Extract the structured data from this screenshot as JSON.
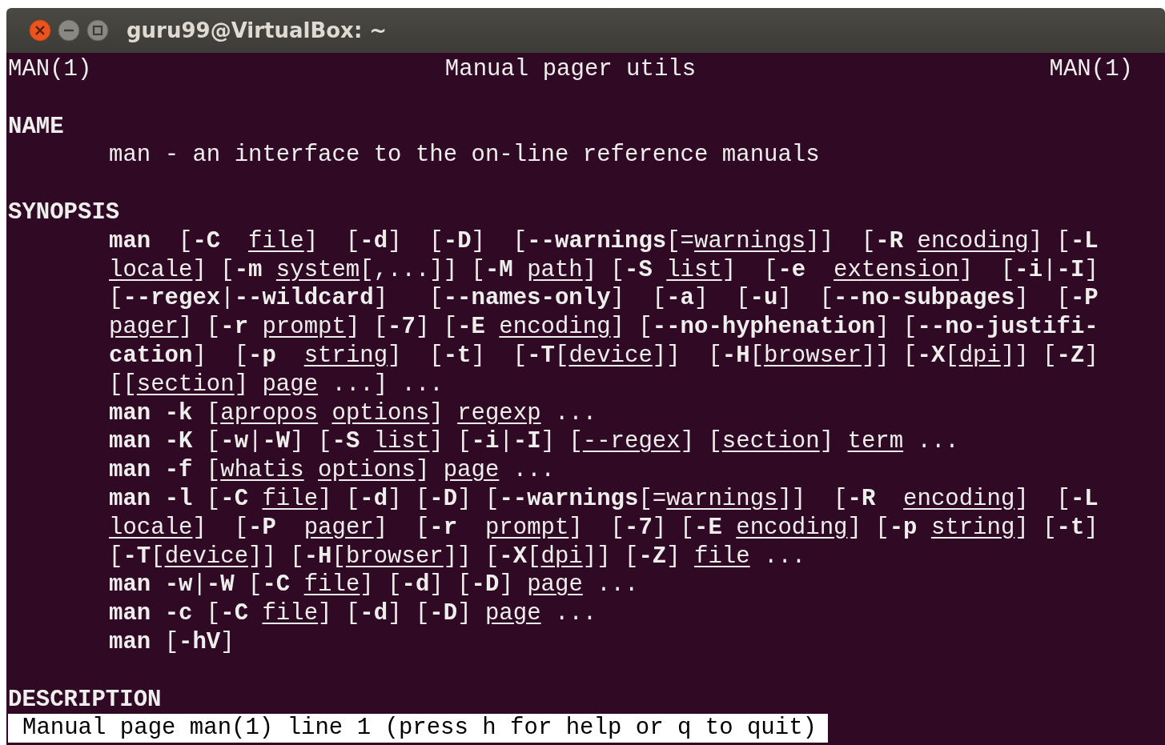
{
  "window": {
    "title": "guru99@VirtualBox: ~"
  },
  "header": {
    "left": "MAN(1)",
    "center": "Manual pager utils",
    "right": "MAN(1)"
  },
  "sections": [
    {
      "heading": "NAME",
      "lines": [
        [
          {
            "kind": "plain",
            "text": "man - an interface to the on-line reference manuals"
          }
        ]
      ]
    },
    {
      "heading": "SYNOPSIS",
      "lines": [
        [
          {
            "kind": "bold",
            "text": "man"
          },
          {
            "kind": "plain",
            "text": "  ["
          },
          {
            "kind": "bold",
            "text": "-C  "
          },
          {
            "kind": "underline",
            "text": "file"
          },
          {
            "kind": "plain",
            "text": "]  ["
          },
          {
            "kind": "bold",
            "text": "-d"
          },
          {
            "kind": "plain",
            "text": "]  ["
          },
          {
            "kind": "bold",
            "text": "-D"
          },
          {
            "kind": "plain",
            "text": "]  ["
          },
          {
            "kind": "bold",
            "text": "--warnings"
          },
          {
            "kind": "plain",
            "text": "[="
          },
          {
            "kind": "underline",
            "text": "warnings"
          },
          {
            "kind": "plain",
            "text": "]]  ["
          },
          {
            "kind": "bold",
            "text": "-R "
          },
          {
            "kind": "underline",
            "text": "encoding"
          },
          {
            "kind": "plain",
            "text": "] ["
          },
          {
            "kind": "bold",
            "text": "-L"
          }
        ],
        [
          {
            "kind": "underline",
            "text": "locale"
          },
          {
            "kind": "plain",
            "text": "] ["
          },
          {
            "kind": "bold",
            "text": "-m "
          },
          {
            "kind": "underline",
            "text": "system"
          },
          {
            "kind": "plain",
            "text": "[,...]] ["
          },
          {
            "kind": "bold",
            "text": "-M "
          },
          {
            "kind": "underline",
            "text": "path"
          },
          {
            "kind": "plain",
            "text": "] ["
          },
          {
            "kind": "bold",
            "text": "-S "
          },
          {
            "kind": "underline",
            "text": "list"
          },
          {
            "kind": "plain",
            "text": "]  ["
          },
          {
            "kind": "bold",
            "text": "-e  "
          },
          {
            "kind": "underline",
            "text": "extension"
          },
          {
            "kind": "plain",
            "text": "]  ["
          },
          {
            "kind": "bold",
            "text": "-i"
          },
          {
            "kind": "plain",
            "text": "|"
          },
          {
            "kind": "bold",
            "text": "-I"
          },
          {
            "kind": "plain",
            "text": "]"
          }
        ],
        [
          {
            "kind": "plain",
            "text": "["
          },
          {
            "kind": "bold",
            "text": "--regex"
          },
          {
            "kind": "plain",
            "text": "|"
          },
          {
            "kind": "bold",
            "text": "--wildcard"
          },
          {
            "kind": "plain",
            "text": "]   ["
          },
          {
            "kind": "bold",
            "text": "--names-only"
          },
          {
            "kind": "plain",
            "text": "]  ["
          },
          {
            "kind": "bold",
            "text": "-a"
          },
          {
            "kind": "plain",
            "text": "]  ["
          },
          {
            "kind": "bold",
            "text": "-u"
          },
          {
            "kind": "plain",
            "text": "]  ["
          },
          {
            "kind": "bold",
            "text": "--no-subpages"
          },
          {
            "kind": "plain",
            "text": "]  ["
          },
          {
            "kind": "bold",
            "text": "-P"
          }
        ],
        [
          {
            "kind": "underline",
            "text": "pager"
          },
          {
            "kind": "plain",
            "text": "] ["
          },
          {
            "kind": "bold",
            "text": "-r "
          },
          {
            "kind": "underline",
            "text": "prompt"
          },
          {
            "kind": "plain",
            "text": "] ["
          },
          {
            "kind": "bold",
            "text": "-7"
          },
          {
            "kind": "plain",
            "text": "] ["
          },
          {
            "kind": "bold",
            "text": "-E "
          },
          {
            "kind": "underline",
            "text": "encoding"
          },
          {
            "kind": "plain",
            "text": "] ["
          },
          {
            "kind": "bold",
            "text": "--no-hyphenation"
          },
          {
            "kind": "plain",
            "text": "] ["
          },
          {
            "kind": "bold",
            "text": "--no-justifi-"
          }
        ],
        [
          {
            "kind": "bold",
            "text": "cation"
          },
          {
            "kind": "plain",
            "text": "]  ["
          },
          {
            "kind": "bold",
            "text": "-p  "
          },
          {
            "kind": "underline",
            "text": "string"
          },
          {
            "kind": "plain",
            "text": "]  ["
          },
          {
            "kind": "bold",
            "text": "-t"
          },
          {
            "kind": "plain",
            "text": "]  ["
          },
          {
            "kind": "bold",
            "text": "-T"
          },
          {
            "kind": "plain",
            "text": "["
          },
          {
            "kind": "underline",
            "text": "device"
          },
          {
            "kind": "plain",
            "text": "]]  ["
          },
          {
            "kind": "bold",
            "text": "-H"
          },
          {
            "kind": "plain",
            "text": "["
          },
          {
            "kind": "underline",
            "text": "browser"
          },
          {
            "kind": "plain",
            "text": "]] ["
          },
          {
            "kind": "bold",
            "text": "-X"
          },
          {
            "kind": "plain",
            "text": "["
          },
          {
            "kind": "underline",
            "text": "dpi"
          },
          {
            "kind": "plain",
            "text": "]] ["
          },
          {
            "kind": "bold",
            "text": "-Z"
          },
          {
            "kind": "plain",
            "text": "]"
          }
        ],
        [
          {
            "kind": "plain",
            "text": "[["
          },
          {
            "kind": "underline",
            "text": "section"
          },
          {
            "kind": "plain",
            "text": "] "
          },
          {
            "kind": "underline",
            "text": "page"
          },
          {
            "kind": "plain",
            "text": " ...] ..."
          }
        ],
        [
          {
            "kind": "bold",
            "text": "man -k"
          },
          {
            "kind": "plain",
            "text": " ["
          },
          {
            "kind": "underline",
            "text": "apropos options"
          },
          {
            "kind": "plain",
            "text": "] "
          },
          {
            "kind": "underline",
            "text": "regexp"
          },
          {
            "kind": "plain",
            "text": " ..."
          }
        ],
        [
          {
            "kind": "bold",
            "text": "man -K"
          },
          {
            "kind": "plain",
            "text": " ["
          },
          {
            "kind": "bold",
            "text": "-w"
          },
          {
            "kind": "plain",
            "text": "|"
          },
          {
            "kind": "bold",
            "text": "-W"
          },
          {
            "kind": "plain",
            "text": "] ["
          },
          {
            "kind": "bold",
            "text": "-S "
          },
          {
            "kind": "underline",
            "text": "list"
          },
          {
            "kind": "plain",
            "text": "] ["
          },
          {
            "kind": "bold",
            "text": "-i"
          },
          {
            "kind": "plain",
            "text": "|"
          },
          {
            "kind": "bold",
            "text": "-I"
          },
          {
            "kind": "plain",
            "text": "] ["
          },
          {
            "kind": "underline",
            "text": "--regex"
          },
          {
            "kind": "plain",
            "text": "] ["
          },
          {
            "kind": "underline",
            "text": "section"
          },
          {
            "kind": "plain",
            "text": "] "
          },
          {
            "kind": "underline",
            "text": "term"
          },
          {
            "kind": "plain",
            "text": " ..."
          }
        ],
        [
          {
            "kind": "bold",
            "text": "man -f"
          },
          {
            "kind": "plain",
            "text": " ["
          },
          {
            "kind": "underline",
            "text": "whatis options"
          },
          {
            "kind": "plain",
            "text": "] "
          },
          {
            "kind": "underline",
            "text": "page"
          },
          {
            "kind": "plain",
            "text": " ..."
          }
        ],
        [
          {
            "kind": "bold",
            "text": "man -l"
          },
          {
            "kind": "plain",
            "text": " ["
          },
          {
            "kind": "bold",
            "text": "-C "
          },
          {
            "kind": "underline",
            "text": "file"
          },
          {
            "kind": "plain",
            "text": "] ["
          },
          {
            "kind": "bold",
            "text": "-d"
          },
          {
            "kind": "plain",
            "text": "] ["
          },
          {
            "kind": "bold",
            "text": "-D"
          },
          {
            "kind": "plain",
            "text": "] ["
          },
          {
            "kind": "bold",
            "text": "--warnings"
          },
          {
            "kind": "plain",
            "text": "[="
          },
          {
            "kind": "underline",
            "text": "warnings"
          },
          {
            "kind": "plain",
            "text": "]]  ["
          },
          {
            "kind": "bold",
            "text": "-R  "
          },
          {
            "kind": "underline",
            "text": "encoding"
          },
          {
            "kind": "plain",
            "text": "]  ["
          },
          {
            "kind": "bold",
            "text": "-L"
          }
        ],
        [
          {
            "kind": "underline",
            "text": "locale"
          },
          {
            "kind": "plain",
            "text": "]  ["
          },
          {
            "kind": "bold",
            "text": "-P  "
          },
          {
            "kind": "underline",
            "text": "pager"
          },
          {
            "kind": "plain",
            "text": "]  ["
          },
          {
            "kind": "bold",
            "text": "-r  "
          },
          {
            "kind": "underline",
            "text": "prompt"
          },
          {
            "kind": "plain",
            "text": "]  ["
          },
          {
            "kind": "bold",
            "text": "-7"
          },
          {
            "kind": "plain",
            "text": "] ["
          },
          {
            "kind": "bold",
            "text": "-E "
          },
          {
            "kind": "underline",
            "text": "encoding"
          },
          {
            "kind": "plain",
            "text": "] ["
          },
          {
            "kind": "bold",
            "text": "-p "
          },
          {
            "kind": "underline",
            "text": "string"
          },
          {
            "kind": "plain",
            "text": "] ["
          },
          {
            "kind": "bold",
            "text": "-t"
          },
          {
            "kind": "plain",
            "text": "]"
          }
        ],
        [
          {
            "kind": "plain",
            "text": "["
          },
          {
            "kind": "bold",
            "text": "-T"
          },
          {
            "kind": "plain",
            "text": "["
          },
          {
            "kind": "underline",
            "text": "device"
          },
          {
            "kind": "plain",
            "text": "]] ["
          },
          {
            "kind": "bold",
            "text": "-H"
          },
          {
            "kind": "plain",
            "text": "["
          },
          {
            "kind": "underline",
            "text": "browser"
          },
          {
            "kind": "plain",
            "text": "]] ["
          },
          {
            "kind": "bold",
            "text": "-X"
          },
          {
            "kind": "plain",
            "text": "["
          },
          {
            "kind": "underline",
            "text": "dpi"
          },
          {
            "kind": "plain",
            "text": "]] ["
          },
          {
            "kind": "bold",
            "text": "-Z"
          },
          {
            "kind": "plain",
            "text": "] "
          },
          {
            "kind": "underline",
            "text": "file"
          },
          {
            "kind": "plain",
            "text": " ..."
          }
        ],
        [
          {
            "kind": "bold",
            "text": "man -w"
          },
          {
            "kind": "plain",
            "text": "|"
          },
          {
            "kind": "bold",
            "text": "-W"
          },
          {
            "kind": "plain",
            "text": " ["
          },
          {
            "kind": "bold",
            "text": "-C "
          },
          {
            "kind": "underline",
            "text": "file"
          },
          {
            "kind": "plain",
            "text": "] ["
          },
          {
            "kind": "bold",
            "text": "-d"
          },
          {
            "kind": "plain",
            "text": "] ["
          },
          {
            "kind": "bold",
            "text": "-D"
          },
          {
            "kind": "plain",
            "text": "] "
          },
          {
            "kind": "underline",
            "text": "page"
          },
          {
            "kind": "plain",
            "text": " ..."
          }
        ],
        [
          {
            "kind": "bold",
            "text": "man -c"
          },
          {
            "kind": "plain",
            "text": " ["
          },
          {
            "kind": "bold",
            "text": "-C "
          },
          {
            "kind": "underline",
            "text": "file"
          },
          {
            "kind": "plain",
            "text": "] ["
          },
          {
            "kind": "bold",
            "text": "-d"
          },
          {
            "kind": "plain",
            "text": "] ["
          },
          {
            "kind": "bold",
            "text": "-D"
          },
          {
            "kind": "plain",
            "text": "] "
          },
          {
            "kind": "underline",
            "text": "page"
          },
          {
            "kind": "plain",
            "text": " ..."
          }
        ],
        [
          {
            "kind": "bold",
            "text": "man"
          },
          {
            "kind": "plain",
            "text": " ["
          },
          {
            "kind": "bold",
            "text": "-hV"
          },
          {
            "kind": "plain",
            "text": "]"
          }
        ]
      ]
    },
    {
      "heading": "DESCRIPTION"
    }
  ],
  "status_line": "Manual page man(1) line 1 (press h for help or q to quit)"
}
